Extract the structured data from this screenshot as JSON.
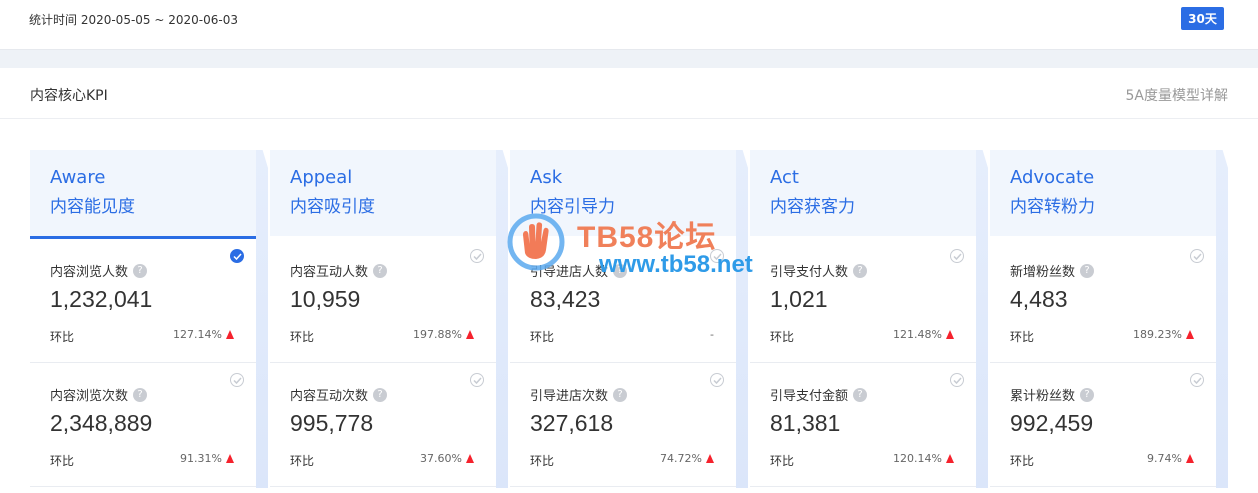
{
  "header": {
    "date_range": "统计时间 2020-05-05 ~ 2020-06-03",
    "period_button": "30天"
  },
  "panel": {
    "title": "内容核心KPI",
    "link": "5A度量模型详解"
  },
  "comparison_label": "环比",
  "help_glyph": "?",
  "columns": [
    {
      "en": "Aware",
      "cn": "内容能见度",
      "active": true,
      "cards": [
        {
          "label": "内容浏览人数",
          "value": "1,232,041",
          "pct": "127.14%",
          "up": true,
          "checked": true
        },
        {
          "label": "内容浏览次数",
          "value": "2,348,889",
          "pct": "91.31%",
          "up": true,
          "checked": false
        }
      ]
    },
    {
      "en": "Appeal",
      "cn": "内容吸引度",
      "active": false,
      "cards": [
        {
          "label": "内容互动人数",
          "value": "10,959",
          "pct": "197.88%",
          "up": true,
          "checked": false
        },
        {
          "label": "内容互动次数",
          "value": "995,778",
          "pct": "37.60%",
          "up": true,
          "checked": false
        }
      ]
    },
    {
      "en": "Ask",
      "cn": "内容引导力",
      "active": false,
      "cards": [
        {
          "label": "引导进店人数",
          "value": "83,423",
          "pct": "-",
          "up": false,
          "checked": false
        },
        {
          "label": "引导进店次数",
          "value": "327,618",
          "pct": "74.72%",
          "up": true,
          "checked": false
        }
      ]
    },
    {
      "en": "Act",
      "cn": "内容获客力",
      "active": false,
      "cards": [
        {
          "label": "引导支付人数",
          "value": "1,021",
          "pct": "121.48%",
          "up": true,
          "checked": false
        },
        {
          "label": "引导支付金额",
          "value": "81,381",
          "pct": "120.14%",
          "up": true,
          "checked": false
        }
      ]
    },
    {
      "en": "Advocate",
      "cn": "内容转粉力",
      "active": false,
      "cards": [
        {
          "label": "新增粉丝数",
          "value": "4,483",
          "pct": "189.23%",
          "up": true,
          "checked": false
        },
        {
          "label": "累计粉丝数",
          "value": "992,459",
          "pct": "9.74%",
          "up": true,
          "checked": false
        }
      ]
    }
  ],
  "watermark": {
    "line1": "TB58论坛",
    "line2": "www.tb58.net"
  },
  "colors": {
    "accent": "#2b6de4",
    "up_arrow": "#f5222d",
    "header_bg": "#f1f6fd"
  }
}
